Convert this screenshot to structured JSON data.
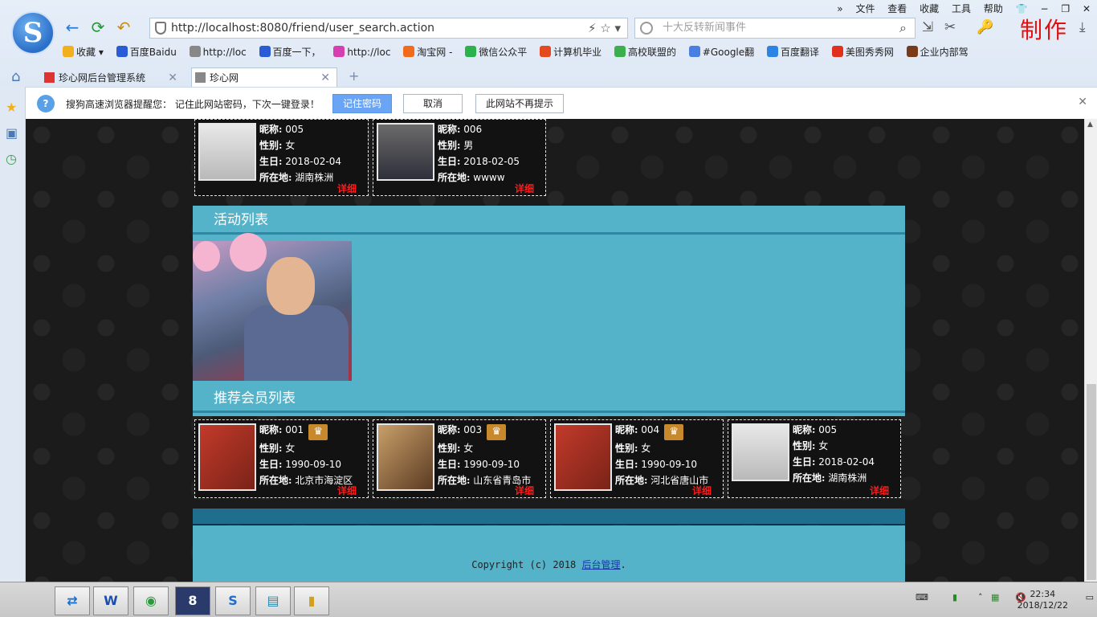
{
  "browser": {
    "menu": [
      "文件",
      "查看",
      "收藏",
      "工具",
      "帮助"
    ],
    "address": "http://localhost:8080/friend/user_search.action",
    "search_placeholder": "十大反转新闻事件",
    "overlay_text": "制作",
    "bookmarks": [
      "收藏",
      "百度Baidu",
      "http://loc",
      "百度一下，",
      "http://loc",
      "淘宝网 -",
      "微信公众平",
      "计算机毕业",
      "高校联盟的",
      "#Google翻",
      "百度翻译",
      "美图秀秀网",
      "企业内部驾"
    ],
    "tabs": [
      {
        "label": "珍心网后台管理系统",
        "active": false
      },
      {
        "label": "珍心网",
        "active": true
      }
    ],
    "notice": {
      "text": "搜狗高速浏览器提醒您：  记住此网站密码，下次一键登录！",
      "remember": "记住密码",
      "cancel": "取消",
      "never": "此网站不再提示"
    }
  },
  "labels": {
    "nickname": "昵称:",
    "gender": "性别:",
    "birthday": "生日:",
    "location": "所在地:",
    "detail": "详细"
  },
  "top_cards": [
    {
      "nickname": "005",
      "gender": "女",
      "birthday": "2018-02-04",
      "location": "湖南株洲"
    },
    {
      "nickname": "006",
      "gender": "男",
      "birthday": "2018-02-05",
      "location": "wwww"
    }
  ],
  "activities_title": "活动列表",
  "members_title": "推荐会员列表",
  "members": [
    {
      "nickname": "001",
      "vip": true,
      "gender": "女",
      "birthday": "1990-09-10",
      "location": "北京市海淀区"
    },
    {
      "nickname": "003",
      "vip": true,
      "gender": "女",
      "birthday": "1990-09-10",
      "location": "山东省青岛市"
    },
    {
      "nickname": "004",
      "vip": true,
      "gender": "女",
      "birthday": "1990-09-10",
      "location": "河北省唐山市"
    },
    {
      "nickname": "005",
      "vip": false,
      "gender": "女",
      "birthday": "2018-02-04",
      "location": "湖南株洲"
    }
  ],
  "footer": {
    "text": "Copyright (c) 2018 ",
    "link": "后台管理",
    "end": "."
  },
  "taskbar": {
    "time": "22:34",
    "date": "2018/12/22"
  }
}
